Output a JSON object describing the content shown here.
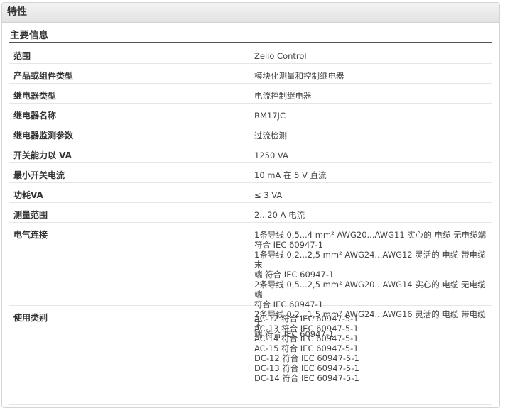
{
  "panel": {
    "title": "特性"
  },
  "section": {
    "title": "主要信息"
  },
  "rows": [
    {
      "label": "范围",
      "value": "Zelio Control"
    },
    {
      "label": "产品或组件类型",
      "value": "模块化测量和控制继电器"
    },
    {
      "label": "继电器类型",
      "value": "电流控制继电器"
    },
    {
      "label": "继电器名称",
      "value": "RM17JC"
    },
    {
      "label": "继电器监测参数",
      "value": "过流检测"
    },
    {
      "label": "开关能力以 VA",
      "value": "1250 VA"
    },
    {
      "label": "最小开关电流",
      "value": "10 mA 在 5 V 直流"
    },
    {
      "label": "功耗VA",
      "value": "≤ 3 VA"
    },
    {
      "label": "测量范围",
      "value": "2...20 A 电流"
    }
  ],
  "electrical_connection": {
    "label": "电气连接",
    "lines": [
      "1条导线 0,5...4 mm² AWG20...AWG11 实心的 电缆 无电缆端",
      "符合 IEC 60947-1",
      "1条导线 0,2...2,5 mm² AWG24...AWG12 灵活的 电缆 带电缆末",
      "端 符合 IEC 60947-1",
      "2条导线 0,5...2,5 mm² AWG20...AWG14 实心的 电缆 无电缆端",
      "符合 IEC 60947-1",
      "2条导线 0,2...1,5 mm² AWG24...AWG16 灵活的 电缆 带电缆末",
      "端 符合 IEC 60947-1"
    ]
  },
  "utilization_category": {
    "label": "使用类别",
    "lines": [
      "AC-12 符合 IEC 60947-5-1",
      "AC-13 符合 IEC 60947-5-1",
      "AC-14 符合 IEC 60947-5-1",
      "AC-15 符合 IEC 60947-5-1",
      "DC-12 符合 IEC 60947-5-1",
      "DC-13 符合 IEC 60947-5-1",
      "DC-14 符合 IEC 60947-5-1"
    ]
  }
}
